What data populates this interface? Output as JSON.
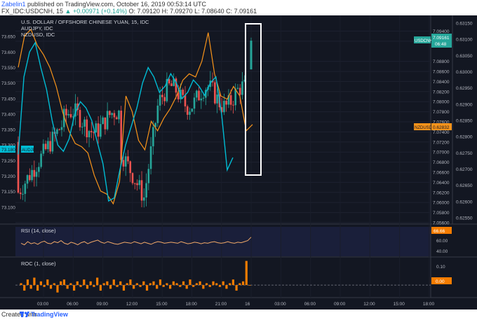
{
  "header": {
    "user": "Zabelin1",
    "published": " published on TradingView.com, October 16, 2019 00:53:14 UTC",
    "symbol": "FX_IDC:USDCNH, 15",
    "change": "▲ +0.00971 (+0.14%)",
    "ohlc": "O: 7.09120 H: 7.09270 L: 7.08640 C: 7.09161"
  },
  "footer": {
    "made_with": "Created with",
    "brand": "TradingView"
  },
  "legend": [
    "U.S. DOLLAR / OFFSHORE CHINESE YUAN, 15, IDC",
    "AUDJPY, IDC",
    "NZDUSD, IDC"
  ],
  "colors": {
    "bg": "#131722",
    "up": "#26a69a",
    "down": "#ef5350",
    "audjpy": "#00bcd4",
    "nzdusd": "#f7931a",
    "roc": "#f57c00",
    "rsi": "#f0a868"
  },
  "chart_data": [
    {
      "type": "candlestick",
      "title": "U.S. DOLLAR / OFFSHORE CHINESE YUAN, 15, IDC",
      "x_ticks": [
        "03:00",
        "06:00",
        "09:00",
        "12:00",
        "15:00",
        "18:00",
        "21:00",
        "16",
        "03:00",
        "06:00",
        "09:00",
        "12:00",
        "15:00",
        "18:00"
      ],
      "right_axis": {
        "ticks": [
          7.094,
          7.092,
          7.088,
          7.086,
          7.084,
          7.082,
          7.08,
          7.078,
          7.076,
          7.074,
          7.072,
          7.07,
          7.068,
          7.066,
          7.064,
          7.062,
          7.06,
          7.058,
          7.056
        ],
        "last_label": "USDCNH",
        "last_value": "7.09161",
        "countdown": "06:48",
        "ylim": [
          7.056,
          7.096
        ]
      },
      "left_axis": {
        "ticks": [
          73.45,
          73.4,
          73.35,
          73.3,
          73.25,
          73.2,
          73.15,
          73.1
        ],
        "label_73_5": "73.500",
        "label_73_55": "73.550",
        "label_73_6": "73.600",
        "label_73_65": "73.650",
        "last_label": "AUDJPY",
        "last_value": "73.180",
        "ylim": [
          73.05,
          73.7
        ]
      },
      "far_right_axis": {
        "ticks": [
          "0.63150",
          "0.63100",
          "0.63050",
          "0.63000",
          "0.62950",
          "0.62900",
          "0.62850",
          "0.62800",
          "0.62750",
          "0.62700",
          "0.62650",
          "0.62600",
          "0.62550"
        ],
        "last_label": "NZDUSD",
        "last_value": "0.62832"
      },
      "series": [
        {
          "name": "AUDJPY, IDC",
          "values": [
            73.27,
            73.52,
            73.6,
            73.63,
            73.55,
            73.48,
            73.38,
            73.3,
            73.28,
            73.32,
            73.4,
            73.44,
            73.42,
            73.38,
            73.31,
            73.24,
            73.12,
            73.13,
            73.22,
            73.3,
            73.36,
            73.42,
            73.5,
            73.55,
            73.52,
            73.47,
            73.49,
            73.53,
            73.5,
            73.45,
            73.47,
            73.51,
            73.49,
            73.46,
            73.5,
            73.52,
            73.4,
            73.22,
            73.26
          ]
        },
        {
          "name": "NZDUSD, IDC",
          "values": [
            0.6302,
            0.6312,
            0.6314,
            0.6309,
            0.6306,
            0.6302,
            0.6296,
            0.6288,
            0.6282,
            0.6278,
            0.6277,
            0.6275,
            0.6268,
            0.6263,
            0.6262,
            0.6259,
            0.6266,
            0.6293,
            0.6288,
            0.6279,
            0.6276,
            0.6285,
            0.6282,
            0.6286,
            0.6289,
            0.6293,
            0.6298,
            0.63,
            0.6299,
            0.6304,
            0.6313,
            0.63,
            0.6293,
            0.6292,
            0.6296,
            0.6293,
            0.6282,
            0.6284
          ]
        }
      ]
    },
    {
      "type": "line",
      "title": "RSI (14, close)",
      "y_ticks": [
        60,
        40
      ],
      "last_value": "66.66",
      "ylim": [
        30,
        85
      ],
      "values": [
        55,
        52,
        58,
        54,
        56,
        53,
        57,
        59,
        55,
        54,
        58,
        56,
        60,
        55,
        53,
        57,
        55,
        52,
        56,
        58,
        54,
        57,
        59,
        61,
        57,
        55,
        58,
        56,
        54,
        53,
        55,
        57,
        56,
        55,
        58,
        56,
        54,
        57,
        55,
        53,
        56,
        58,
        57,
        55,
        56,
        57,
        56,
        55,
        58,
        56,
        54,
        55,
        57,
        56,
        54,
        56,
        55,
        57,
        58,
        56,
        55,
        56,
        58,
        56,
        55,
        57,
        56,
        58,
        60,
        66.66
      ]
    },
    {
      "type": "bar",
      "title": "ROC (1, close)",
      "y_ticks": [
        0.1
      ],
      "last_value": "0.00",
      "ylim": [
        -0.06,
        0.14
      ],
      "values": [
        0.01,
        -0.03,
        0.03,
        -0.02,
        0.04,
        -0.03,
        0.02,
        -0.01,
        0.03,
        -0.02,
        0.01,
        -0.04,
        0.02,
        0.03,
        -0.02,
        0.01,
        -0.03,
        0.02,
        -0.01,
        0.03,
        -0.02,
        0.02,
        -0.01,
        0.04,
        -0.03,
        0.01,
        0.02,
        -0.02,
        0.03,
        -0.01,
        0.02,
        -0.03,
        0.01,
        0.03,
        -0.02,
        0.01,
        -0.01,
        0.02,
        -0.03,
        0.01,
        0.02,
        -0.02,
        0.03,
        -0.01,
        0.01,
        -0.02,
        0.02,
        0.01,
        -0.01,
        0.02,
        -0.02,
        0.03,
        -0.01,
        0.01,
        0.02,
        -0.02,
        0.01,
        -0.01,
        0.02,
        0.01,
        -0.01,
        0.02,
        -0.02,
        0.01,
        0.03,
        -0.03,
        0.01,
        0.02,
        0.13,
        0.0
      ]
    }
  ]
}
